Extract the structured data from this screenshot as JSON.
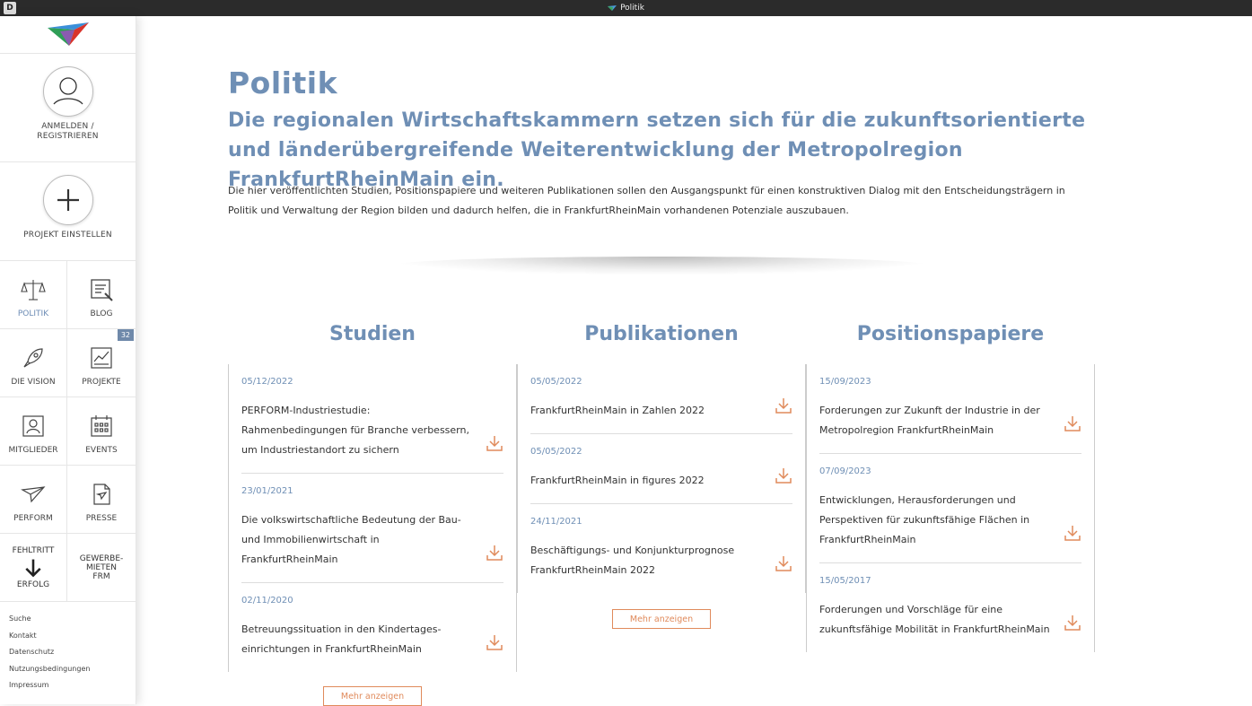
{
  "window": {
    "title": "Politik"
  },
  "sidebar": {
    "login_label_1": "ANMELDEN /",
    "login_label_2": "REGISTRIEREN",
    "project_label": "PROJEKT EINSTELLEN",
    "nav": [
      {
        "label": "POLITIK",
        "icon": "scales-icon"
      },
      {
        "label": "BLOG",
        "icon": "blog-icon"
      },
      {
        "label": "DIE VISION",
        "icon": "rocket-icon"
      },
      {
        "label": "PROJEKTE",
        "icon": "chart-icon",
        "badge": "32"
      },
      {
        "label": "MITGLIEDER",
        "icon": "member-icon"
      },
      {
        "label": "EVENTS",
        "icon": "calendar-icon"
      },
      {
        "label": "PERFORM",
        "icon": "plane-icon"
      },
      {
        "label": "PRESSE",
        "icon": "document-icon"
      },
      {
        "label_top": "FEHLTRITT",
        "label": "ERFOLG",
        "icon": "arrow-down-icon"
      },
      {
        "label_1": "GEWERBE-",
        "label_2": "MIETEN",
        "label_3": "FRM"
      }
    ],
    "footer": [
      "Suche",
      "Kontakt",
      "Datenschutz",
      "Nutzungsbedingungen",
      "Impressum"
    ]
  },
  "main": {
    "title": "Politik",
    "subtitle": "Die regionalen Wirtschaftskammern setzen sich für die zukunftsorientierte und länderübergreifende Weiterentwicklung der Metropolregion FrankfurtRheinMain ein.",
    "intro": "Die hier veröffentlichten Studien, Positionspapiere und weiteren Publikationen sollen den Ausgangspunkt für einen konstruktiven Dialog mit den Entscheidungsträgern in Politik und Verwaltung der Region bilden und dadurch helfen, die in FrankfurtRheinMain vorhandenen Potenziale auszubauen.",
    "columns": [
      {
        "heading": "Studien",
        "more": "Mehr anzeigen",
        "items": [
          {
            "date": "05/12/2022",
            "title": "PERFORM-Industriestudie: Rahmenbedingungen für Branche verbessern, um Industriestandort zu sichern"
          },
          {
            "date": "23/01/2021",
            "title": "Die volkswirtschaftliche Bedeutung der Bau- und Immobilienwirtschaft in FrankfurtRheinMain"
          },
          {
            "date": "02/11/2020",
            "title": "Betreuungssituation in den Kindertages-einrichtungen in FrankfurtRheinMain"
          }
        ]
      },
      {
        "heading": "Publikationen",
        "more": "Mehr anzeigen",
        "items": [
          {
            "date": "05/05/2022",
            "title": "FrankfurtRheinMain in Zahlen 2022"
          },
          {
            "date": "05/05/2022",
            "title": "FrankfurtRheinMain in figures 2022"
          },
          {
            "date": "24/11/2021",
            "title": "Beschäftigungs- und Konjunkturprognose FrankfurtRheinMain 2022"
          }
        ]
      },
      {
        "heading": "Positionspapiere",
        "items": [
          {
            "date": "15/09/2023",
            "title": "Forderungen zur Zukunft der Industrie in der Metropolregion FrankfurtRheinMain"
          },
          {
            "date": "07/09/2023",
            "title": "Entwicklungen, Herausforderungen und Perspektiven für zukunftsfähige Flächen in FrankfurtRheinMain"
          },
          {
            "date": "15/05/2017",
            "title": "Forderungen und Vorschläge für eine zukunftsfähige Mobilität in FrankfurtRheinMain"
          }
        ]
      }
    ]
  },
  "colors": {
    "accent_blue": "#6f8fb5",
    "accent_orange": "#e08a5b"
  }
}
